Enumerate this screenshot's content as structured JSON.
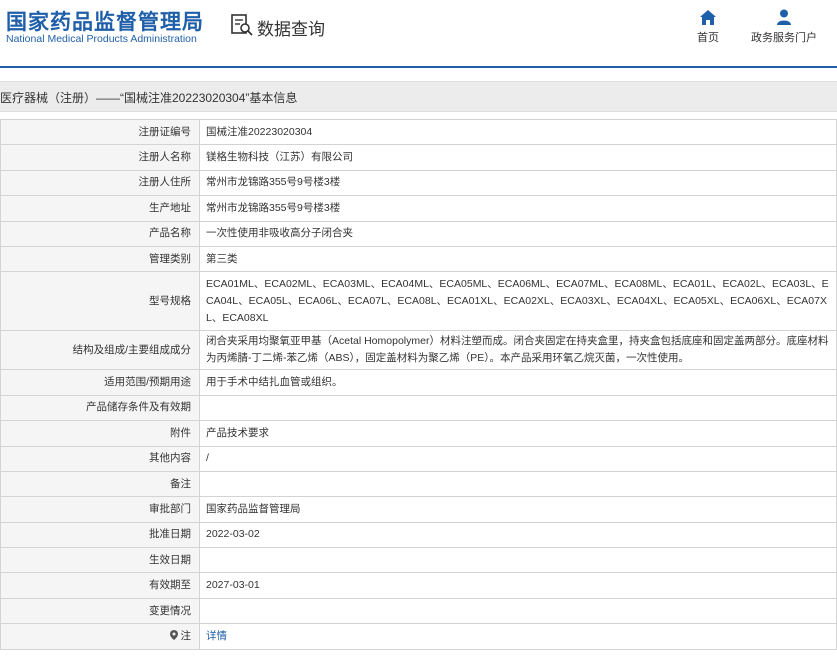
{
  "header": {
    "logo_cn": "国家药品监督管理局",
    "logo_en": "National Medical Products Administration",
    "query_title": "数据查询",
    "nav": {
      "home": "首页",
      "portal": "政务服务门户"
    },
    "colors": {
      "brand": "#1f5fa9"
    }
  },
  "page_title": "医疗器械（注册）——“国械注准20223020304”基本信息",
  "rows": [
    {
      "label": "注册证编号",
      "value": "国械注准20223020304"
    },
    {
      "label": "注册人名称",
      "value": "镁格生物科技（江苏）有限公司"
    },
    {
      "label": "注册人住所",
      "value": "常州市龙锦路355号9号楼3楼"
    },
    {
      "label": "生产地址",
      "value": "常州市龙锦路355号9号楼3楼"
    },
    {
      "label": "产品名称",
      "value": "一次性使用非吸收高分子闭合夹"
    },
    {
      "label": "管理类别",
      "value": "第三类"
    },
    {
      "label": "型号规格",
      "value": "ECA01ML、ECA02ML、ECA03ML、ECA04ML、ECA05ML、ECA06ML、ECA07ML、ECA08ML、ECA01L、ECA02L、ECA03L、ECA04L、ECA05L、ECA06L、ECA07L、ECA08L、ECA01XL、ECA02XL、ECA03XL、ECA04XL、ECA05XL、ECA06XL、ECA07XL、ECA08XL"
    },
    {
      "label": "结构及组成/主要组成成分",
      "value": "闭合夹采用均聚氧亚甲基（Acetal Homopolymer）材料注塑而成。闭合夹固定在持夹盒里，持夹盒包括底座和固定盖两部分。底座材料为丙烯腈-丁二烯-苯乙烯（ABS），固定盖材料为聚乙烯（PE）。本产品采用环氧乙烷灭菌，一次性使用。"
    },
    {
      "label": "适用范围/预期用途",
      "value": "用于手术中结扎血管或组织。"
    },
    {
      "label": "产品储存条件及有效期",
      "value": ""
    },
    {
      "label": "附件",
      "value": "产品技术要求"
    },
    {
      "label": "其他内容",
      "value": "/"
    },
    {
      "label": "备注",
      "value": ""
    },
    {
      "label": "审批部门",
      "value": "国家药品监督管理局"
    },
    {
      "label": "批准日期",
      "value": "2022-03-02"
    },
    {
      "label": "生效日期",
      "value": ""
    },
    {
      "label": "有效期至",
      "value": "2027-03-01"
    },
    {
      "label": "变更情况",
      "value": ""
    },
    {
      "label": "注",
      "value": "详情"
    }
  ]
}
